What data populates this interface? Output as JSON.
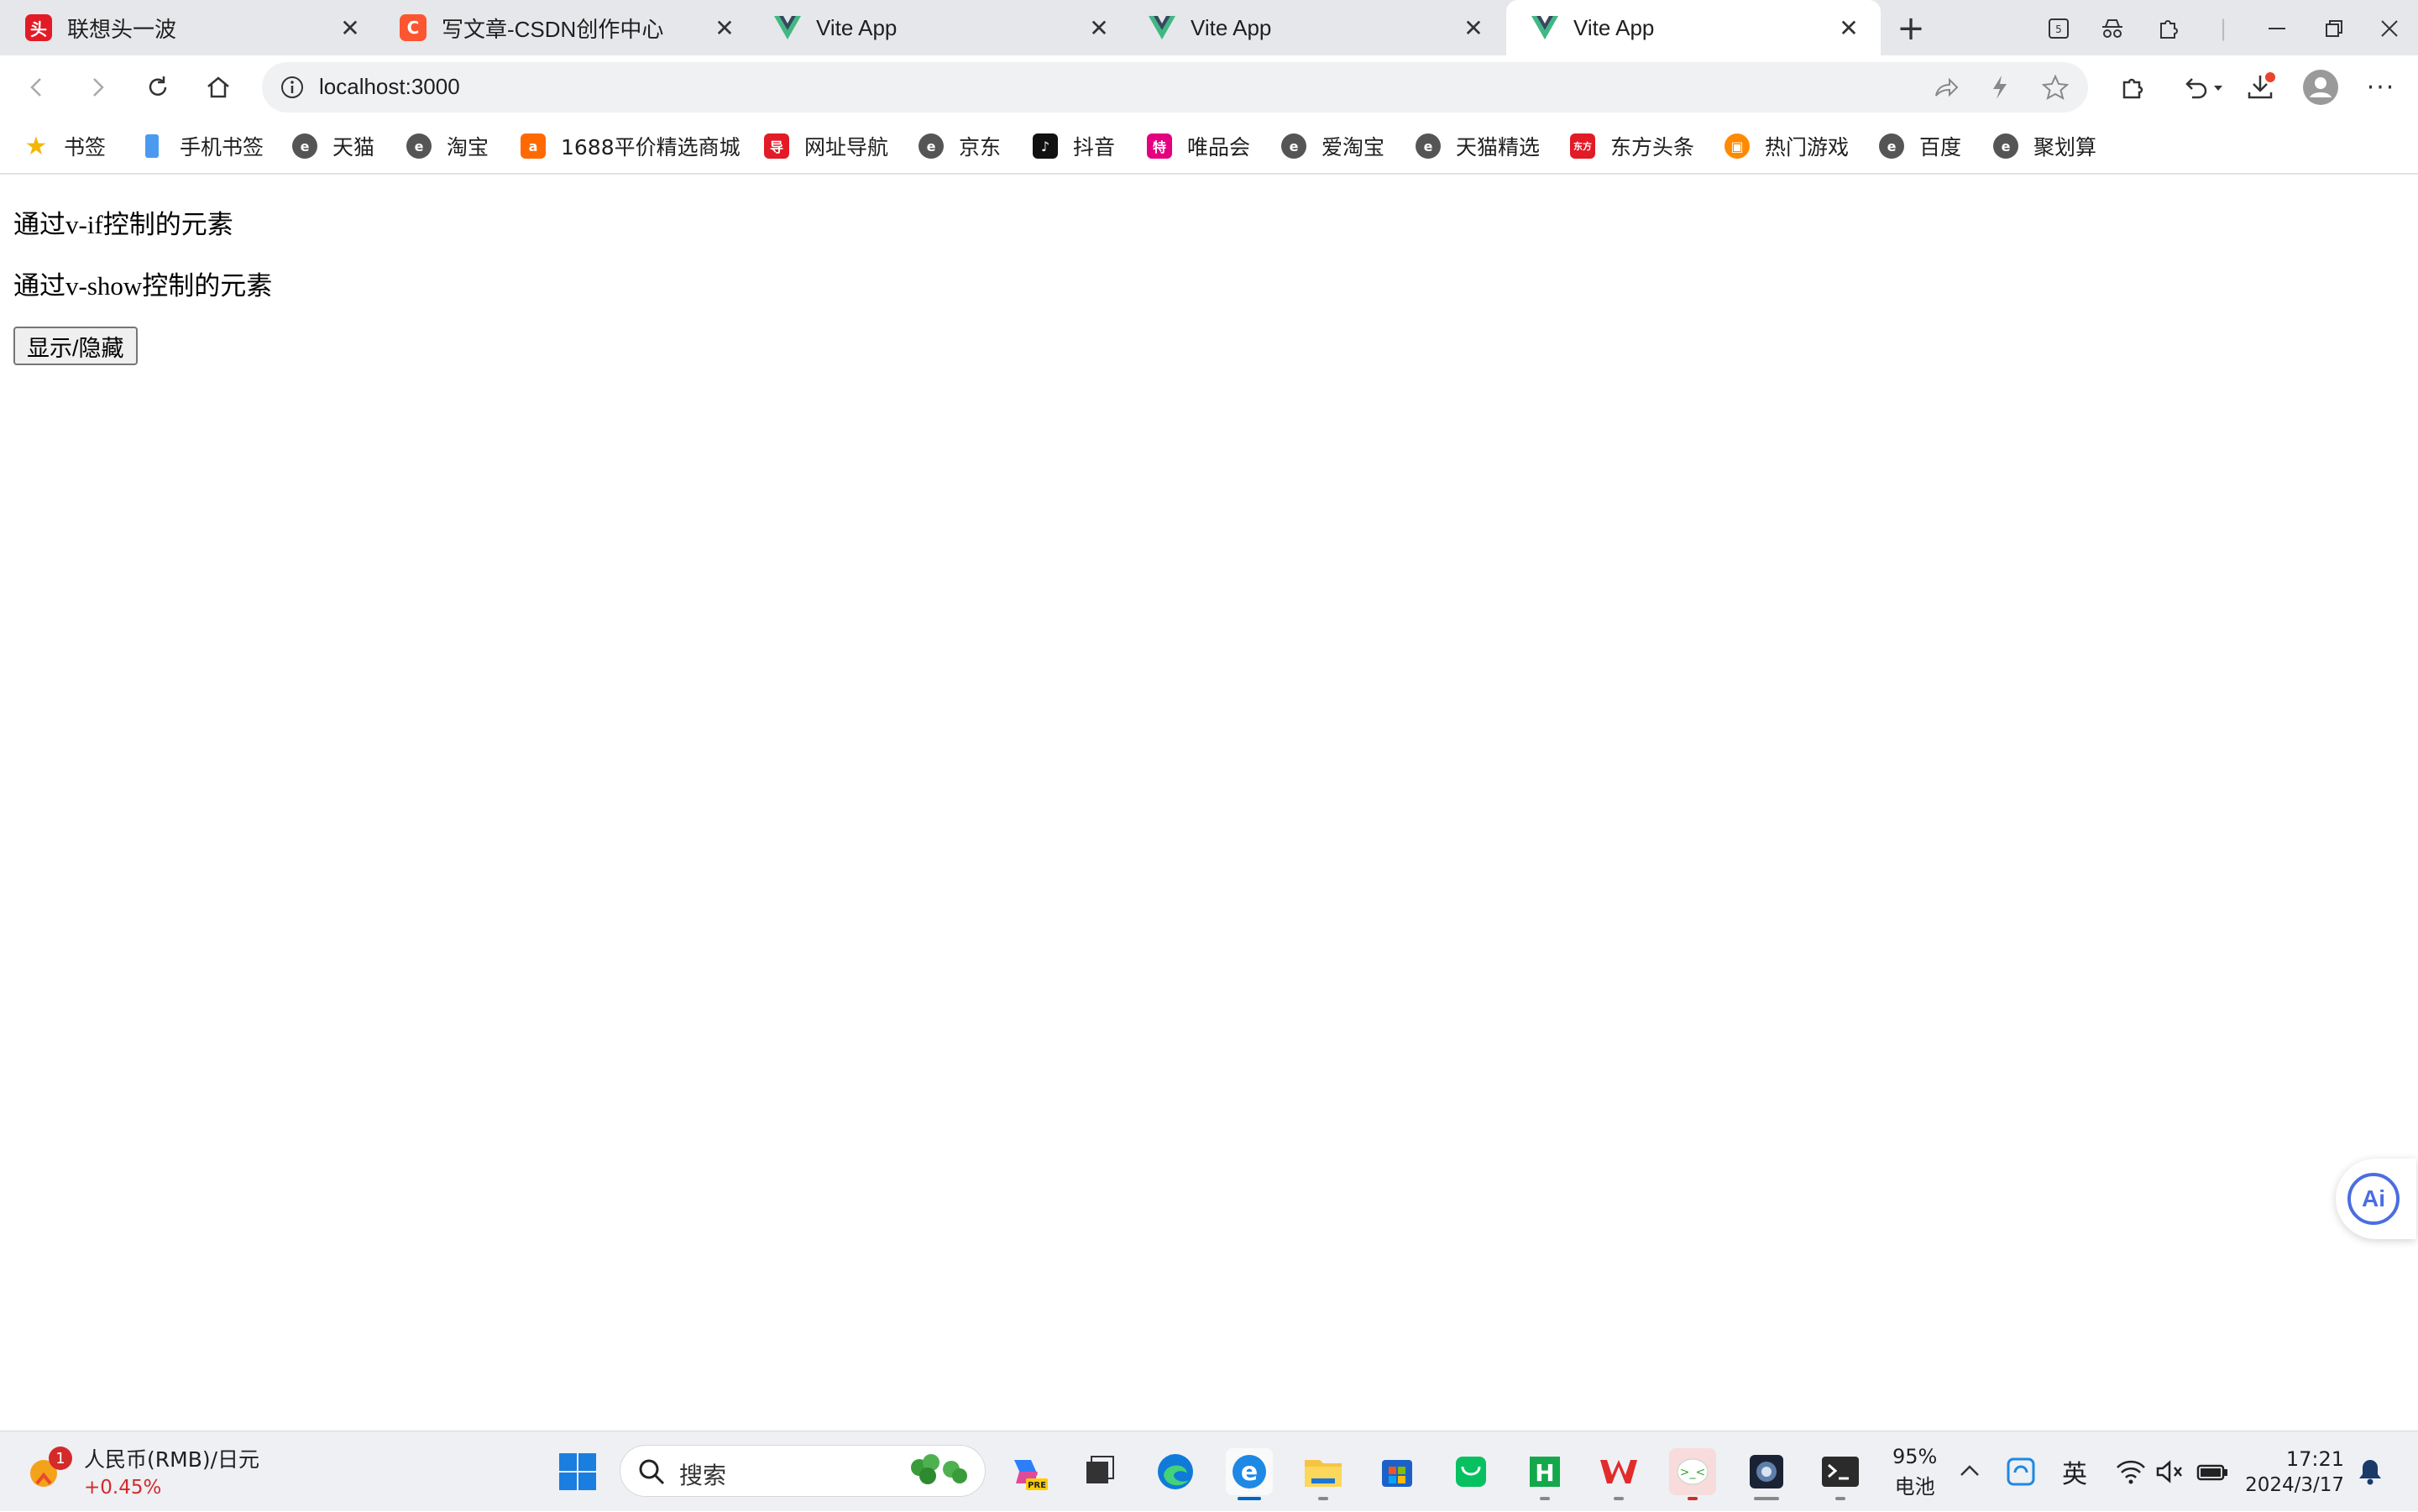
{
  "tabs": [
    {
      "title": "联想头一波",
      "fav_text": "头",
      "fav_color": "#e21b26"
    },
    {
      "title": "写文章-CSDN创作中心",
      "fav_text": "C",
      "fav_color": "#fc5531"
    },
    {
      "title": "Vite App",
      "fav_text": "",
      "fav_color": "#41b883"
    },
    {
      "title": "Vite App",
      "fav_text": "",
      "fav_color": "#41b883"
    },
    {
      "title": "Vite App",
      "fav_text": "",
      "fav_color": "#41b883",
      "active": true
    }
  ],
  "address_bar": {
    "url": "localhost:3000"
  },
  "bookmarks": [
    {
      "label": "书签",
      "icon": "star-icon",
      "color": "#f2b705"
    },
    {
      "label": "手机书签",
      "icon": "phone-icon",
      "color": "#4a9bf0"
    },
    {
      "label": "天猫",
      "icon": "globe-e-icon",
      "color": "#555555"
    },
    {
      "label": "淘宝",
      "icon": "globe-e-icon",
      "color": "#555555"
    },
    {
      "label": "1688平价精选商城",
      "icon": "alibaba-icon",
      "color": "#ff6a00"
    },
    {
      "label": "网址导航",
      "icon": "nav-icon",
      "color": "#e21b26"
    },
    {
      "label": "京东",
      "icon": "globe-e-icon",
      "color": "#555555"
    },
    {
      "label": "抖音",
      "icon": "tiktok-icon",
      "color": "#111111"
    },
    {
      "label": "唯品会",
      "icon": "vip-icon",
      "color": "#e4007f"
    },
    {
      "label": "爱淘宝",
      "icon": "globe-e-icon",
      "color": "#555555"
    },
    {
      "label": "天猫精选",
      "icon": "globe-e-icon",
      "color": "#555555"
    },
    {
      "label": "东方头条",
      "icon": "dftt-icon",
      "color": "#e21b26"
    },
    {
      "label": "热门游戏",
      "icon": "game-icon",
      "color": "#ff8a00"
    },
    {
      "label": "百度",
      "icon": "globe-e-icon",
      "color": "#555555"
    },
    {
      "label": "聚划算",
      "icon": "globe-e-icon",
      "color": "#555555"
    }
  ],
  "page": {
    "vif_text": "通过v-if控制的元素",
    "vshow_text": "通过v-show控制的元素",
    "toggle_button": "显示/隐藏"
  },
  "taskbar": {
    "currency_title": "人民币(RMB)/日元",
    "currency_change": "+0.45%",
    "currency_badge": "1",
    "search_placeholder": "搜索",
    "battery_percent": "95%",
    "battery_label": "电池",
    "ime": "英",
    "time": "17:21",
    "date": "2024/3/17"
  },
  "colors": {
    "accent": "#0067c0",
    "page_bg": "#ffffff",
    "tabstrip_bg": "#e6e7ea"
  }
}
